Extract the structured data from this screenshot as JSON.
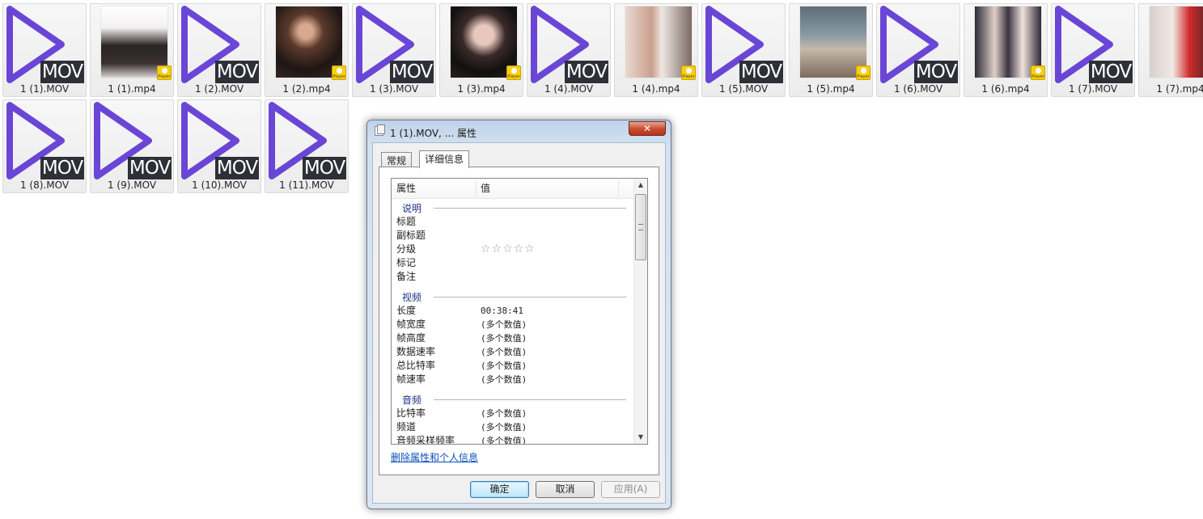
{
  "files": [
    {
      "label": "1 (1).MOV",
      "type": "mov"
    },
    {
      "label": "1 (1).mp4",
      "type": "mp4",
      "photo": "bg1"
    },
    {
      "label": "1 (2).MOV",
      "type": "mov"
    },
    {
      "label": "1 (2).mp4",
      "type": "mp4",
      "photo": "bg2"
    },
    {
      "label": "1 (3).MOV",
      "type": "mov"
    },
    {
      "label": "1 (3).mp4",
      "type": "mp4",
      "photo": "bg3"
    },
    {
      "label": "1 (4).MOV",
      "type": "mov"
    },
    {
      "label": "1 (4).mp4",
      "type": "mp4",
      "photo": "bg4"
    },
    {
      "label": "1 (5).MOV",
      "type": "mov"
    },
    {
      "label": "1 (5).mp4",
      "type": "mp4",
      "photo": "bg5"
    },
    {
      "label": "1 (6).MOV",
      "type": "mov"
    },
    {
      "label": "1 (6).mp4",
      "type": "mp4",
      "photo": "bg6"
    },
    {
      "label": "1 (7).MOV",
      "type": "mov"
    },
    {
      "label": "1 (7).mp4",
      "type": "mp4",
      "photo": "bg7"
    },
    {
      "label": "1 (8).MOV",
      "type": "mov"
    },
    {
      "label": "1 (9).MOV",
      "type": "mov"
    },
    {
      "label": "1 (10).MOV",
      "type": "mov"
    },
    {
      "label": "1 (11).MOV",
      "type": "mov"
    }
  ],
  "badges": {
    "mov": "MOV",
    "player": "Player"
  },
  "colors": {
    "play_triangle": "#6a46d6",
    "mov_badge": "#2e3038",
    "player_badge": "#f6cf16",
    "link": "#0b51b8",
    "group_header": "#1e3287"
  },
  "dialog": {
    "title": "1 (1).MOV, ... 属性",
    "close_glyph": "✕",
    "tabs": [
      {
        "label": "常规"
      },
      {
        "label": "详细信息"
      }
    ],
    "active_tab": 1,
    "columns": {
      "property": "属性",
      "value": "值"
    },
    "groups": [
      {
        "name": "说明",
        "rows": [
          {
            "name": "标题",
            "value": ""
          },
          {
            "name": "副标题",
            "value": ""
          },
          {
            "name": "分级",
            "stars": "☆☆☆☆☆"
          },
          {
            "name": "标记",
            "value": ""
          },
          {
            "name": "备注",
            "value": ""
          }
        ]
      },
      {
        "name": "视频",
        "rows": [
          {
            "name": "长度",
            "value": "00:38:41"
          },
          {
            "name": "帧宽度",
            "value": "(多个数值)"
          },
          {
            "name": "帧高度",
            "value": "(多个数值)"
          },
          {
            "name": "数据速率",
            "value": "(多个数值)"
          },
          {
            "name": "总比特率",
            "value": "(多个数值)"
          },
          {
            "name": "帧速率",
            "value": "(多个数值)"
          }
        ]
      },
      {
        "name": "音频",
        "rows": [
          {
            "name": "比特率",
            "value": "(多个数值)"
          },
          {
            "name": "频道",
            "value": "(多个数值)"
          },
          {
            "name": "音频采样频率",
            "value": "(多个数值)"
          }
        ]
      }
    ],
    "remove_link": "删除属性和个人信息",
    "buttons": {
      "ok": "确定",
      "cancel": "取消",
      "apply": "应用(A)"
    },
    "scroll_up": "▲",
    "scroll_down": "▼"
  }
}
